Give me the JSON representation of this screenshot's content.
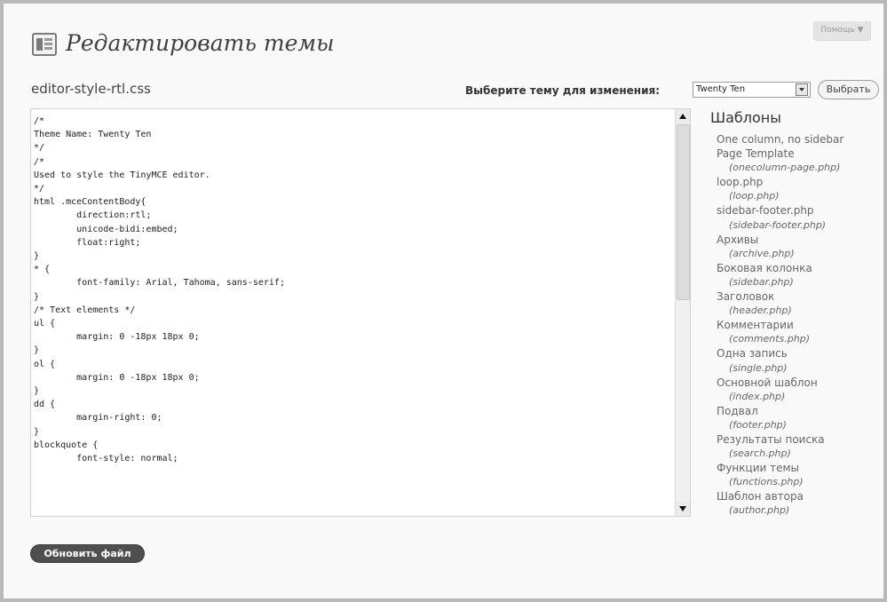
{
  "header": {
    "title": "Редактировать темы",
    "help_label": "Помощь ▼"
  },
  "editor": {
    "file_name": "editor-style-rtl.css",
    "theme_label": "Выберите тему для изменения:",
    "theme_selected": "Twenty Ten",
    "select_button": "Выбрать",
    "update_button": "Обновить файл",
    "code": "/*\nTheme Name: Twenty Ten\n*/\n/*\nUsed to style the TinyMCE editor.\n*/\nhtml .mceContentBody{\n        direction:rtl;\n        unicode-bidi:embed;\n        float:right;\n}\n* {\n        font-family: Arial, Tahoma, sans-serif;\n}\n/* Text elements */\nul {\n        margin: 0 -18px 18px 0;\n}\nol {\n        margin: 0 -18px 18px 0;\n}\ndd {\n        margin-right: 0;\n}\nblockquote {\n        font-style: normal;"
  },
  "sidebar": {
    "title": "Шаблоны",
    "items": [
      {
        "name": "One column, no sidebar Page Template",
        "file": "(onecolumn-page.php)"
      },
      {
        "name": "loop.php",
        "file": "(loop.php)"
      },
      {
        "name": "sidebar-footer.php",
        "file": "(sidebar-footer.php)"
      },
      {
        "name": "Архивы",
        "file": "(archive.php)"
      },
      {
        "name": "Боковая колонка",
        "file": "(sidebar.php)"
      },
      {
        "name": "Заголовок",
        "file": "(header.php)"
      },
      {
        "name": "Комментарии",
        "file": "(comments.php)"
      },
      {
        "name": "Одна запись",
        "file": "(single.php)"
      },
      {
        "name": "Основной шаблон",
        "file": "(index.php)"
      },
      {
        "name": "Подвал",
        "file": "(footer.php)"
      },
      {
        "name": "Результаты поиска",
        "file": "(search.php)"
      },
      {
        "name": "Функции темы",
        "file": "(functions.php)"
      },
      {
        "name": "Шаблон автора",
        "file": "(author.php)"
      }
    ]
  },
  "colors": {
    "frame_border": "#b8b8b8",
    "page_background": "#f9f9f9",
    "primary_button": "#4f4f4f"
  },
  "icons": {
    "page_icon": "theme-editor-icon",
    "select_arrow": "chevron-down-icon",
    "scroll_up": "scroll-up-arrow-icon",
    "scroll_down": "scroll-down-arrow-icon"
  }
}
